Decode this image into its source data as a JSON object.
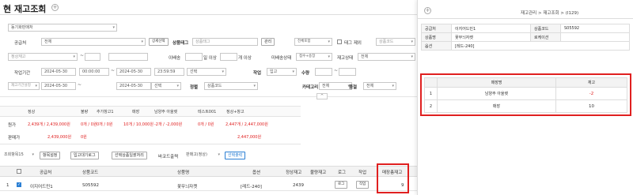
{
  "page": {
    "title": "현 재고조회",
    "fav_icon": "plus-circle-icon"
  },
  "filters": {
    "dup_select": "동기화판매처",
    "supplier_label": "공급처",
    "supplier_value": "전체",
    "detail_select_btn": "상세선택",
    "product_tag_label": "상품태그",
    "product_tag_placeholder": "상품태그",
    "manage_btn": "관리",
    "all_select": "전체포함",
    "tag_exclude_label": "태그 제외",
    "product_code_select": "상품코드",
    "normal_stock_select": "정상재고",
    "weekly_sales_label": "이배송",
    "day_label": "일 이상",
    "count_label": "개 이상",
    "undelivered_label": "미배송상태",
    "undelivered_value": "접수+송장",
    "stock_status_label": "재고상태",
    "stock_status_value": "전체",
    "period_label": "작업기간",
    "date_from": "2024-05-30",
    "time_from": "00:00:00",
    "date_to": "2024-05-30",
    "time_to": "23:59:59",
    "select_label": "선택",
    "work_label": "작업",
    "work_value": "입고",
    "qty_label": "수량",
    "stock_period_select": "재고기간설정",
    "date_from2": "2024-05-30",
    "date_to2": "2024-05-30",
    "select2": "선택",
    "sort_label": "정렬",
    "sort_value": "상품코드",
    "category_label": "카테고리",
    "category_value": "전체",
    "quality_label": "품절",
    "quality_value": "전체",
    "expand_icon": "chevron-up-icon"
  },
  "summary": {
    "headers": [
      "정상",
      "불량",
      "추가창고1",
      "매장",
      "남양주 아울렛",
      "테스트001",
      "정상+창고"
    ],
    "row1_label": "원가",
    "row1": [
      "2,439개 / 2,439,000원",
      "0개 / 0원",
      "0개 / 0원",
      "10개 / 10,000원",
      "-2개 / -2,000원",
      "0개 / 0원",
      "2,447개 / 2,447,000원"
    ],
    "row2_label": "판매가",
    "row2": [
      "2,439,000원",
      "0원",
      "",
      "",
      "",
      "",
      "2,447,000원"
    ]
  },
  "toolbar": {
    "items_select": "조회항목15",
    "item_settings": "항목설정",
    "inout_log": "입고대기로그",
    "select_process": "선택상품일괄처리",
    "barcode_label": "바코드출력",
    "barcode_select": "판매고(정상)",
    "select_print": "선택출력"
  },
  "grid": {
    "headers": [
      "공급처",
      "상품코드",
      "상품명",
      "옵션",
      "정상재고",
      "불량재고",
      "로그",
      "작업",
      "매장총재고"
    ],
    "rows": [
      {
        "num": "1",
        "supplier": "이지어드민1",
        "code": "S05592",
        "name": "꽃무늬자켓",
        "option": "[레드-240]",
        "normal": "2439",
        "bad": "",
        "log": "로그",
        "work": "작업",
        "store_total": "9"
      }
    ]
  },
  "panel": {
    "crumbs": "재고관리 > 재고조회 > (I129)",
    "info": [
      {
        "k": "공급처",
        "v": "이지어드민1",
        "k2": "상품코드",
        "v2": "S05592"
      },
      {
        "k": "상품명",
        "v": "꽃무늬자켓",
        "k2": "로케이션",
        "v2": ""
      },
      {
        "k": "옵션",
        "v": "[레드-240]",
        "k2": "",
        "v2": ""
      }
    ],
    "table_headers": [
      "매장명",
      "재고"
    ],
    "table_rows": [
      {
        "n": "1",
        "name": "남양주 아울렛",
        "qty": "-2"
      },
      {
        "n": "2",
        "name": "매장",
        "qty": "10"
      }
    ],
    "highlight_color": "#e02020"
  }
}
